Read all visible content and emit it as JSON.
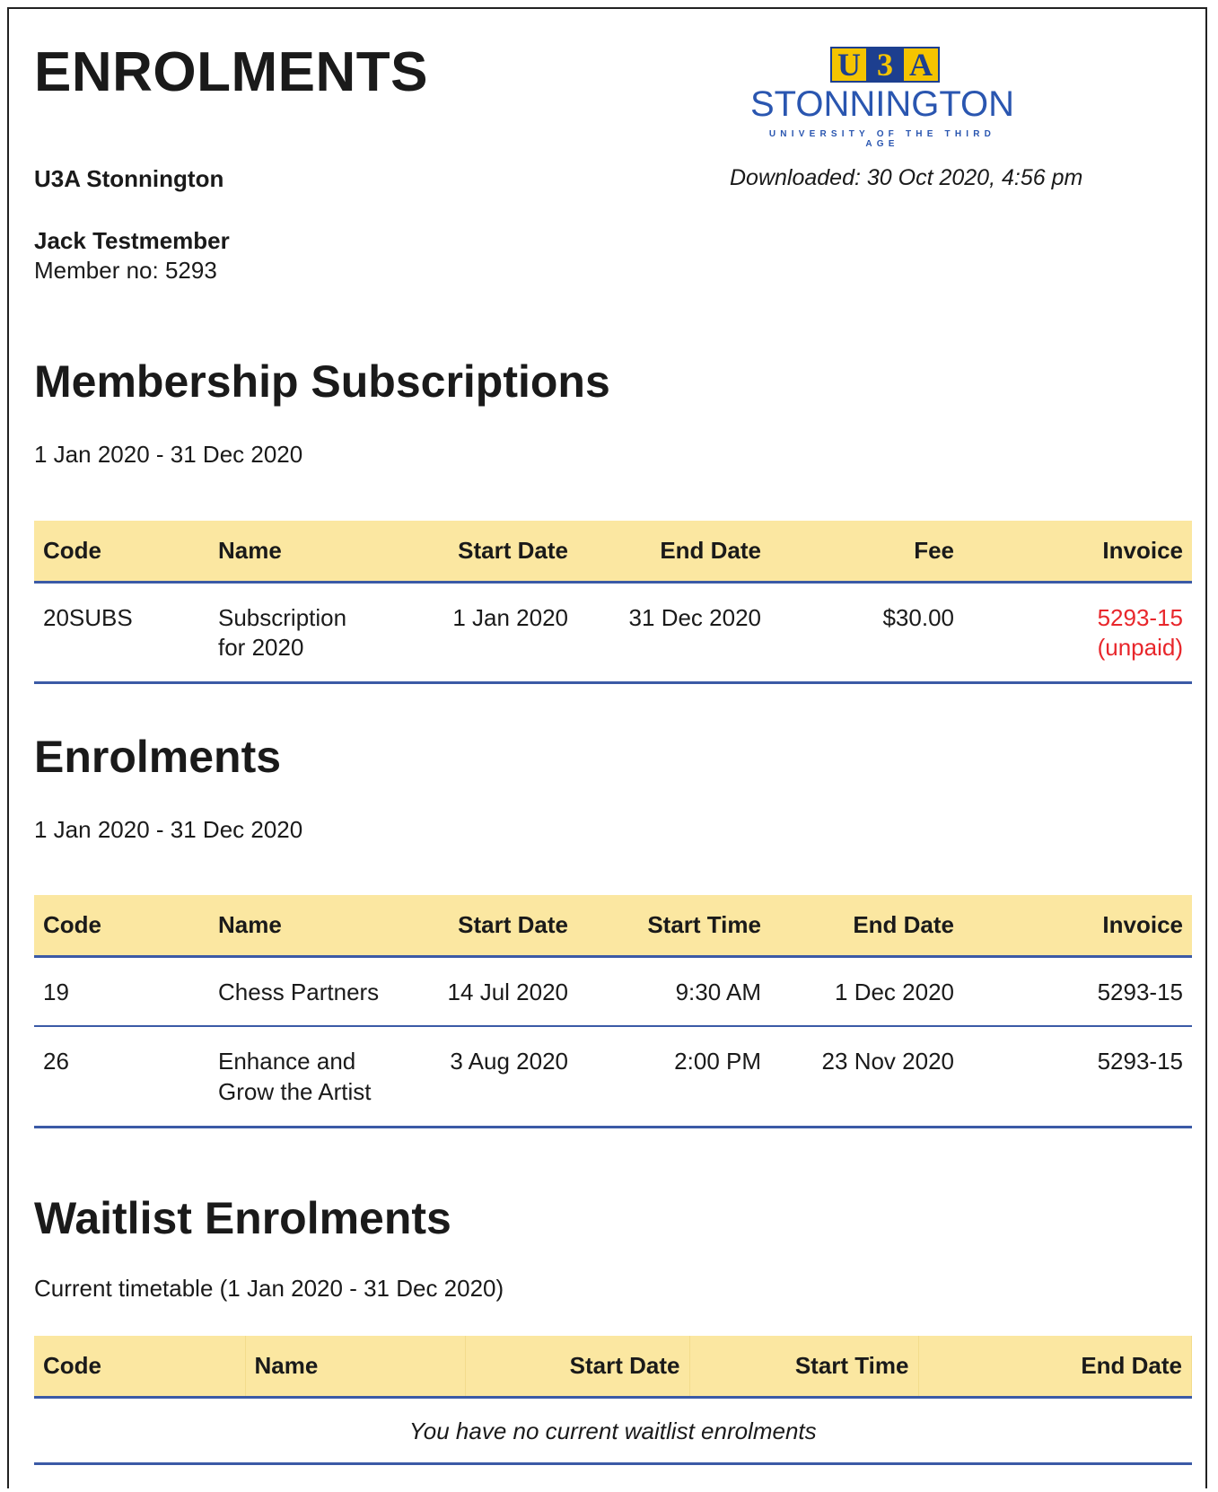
{
  "document": {
    "title": "ENROLMENTS",
    "org_name": "U3A Stonnington",
    "downloaded": "Downloaded: 30 Oct 2020, 4:56 pm",
    "member_name": "Jack Testmember",
    "member_no": "Member no: 5293"
  },
  "logo": {
    "letters": [
      "U",
      "3",
      "A"
    ],
    "name": "STONNINGTON",
    "tagline": "UNIVERSITY OF THE THIRD AGE",
    "colors": {
      "blue": "#1d3f8f",
      "yellow": "#f5c400",
      "text_blue": "#2a56b0"
    }
  },
  "colors": {
    "header_bg": "#fbe7a1",
    "rule": "#3b5aa6",
    "unpaid": "#e8262b"
  },
  "subscriptions": {
    "title": "Membership Subscriptions",
    "period": "1 Jan 2020 - 31 Dec 2020",
    "columns": [
      "Code",
      "Name",
      "Start Date",
      "End Date",
      "Fee",
      "Invoice"
    ],
    "rows": [
      {
        "code": "20SUBS",
        "name_line1": "Subscription",
        "name_line2": "for 2020",
        "start": "1 Jan 2020",
        "end": "31 Dec 2020",
        "fee": "$30.00",
        "invoice": "5293-15",
        "invoice_status": "(unpaid)"
      }
    ]
  },
  "enrolments": {
    "title": "Enrolments",
    "period": "1 Jan 2020 - 31 Dec 2020",
    "columns": [
      "Code",
      "Name",
      "Start Date",
      "Start Time",
      "End Date",
      "Invoice"
    ],
    "rows": [
      {
        "code": "19",
        "name_line1": "Chess Partners",
        "name_line2": "",
        "start": "14 Jul 2020",
        "time": "9:30 AM",
        "end": "1 Dec 2020",
        "invoice": "5293-15"
      },
      {
        "code": "26",
        "name_line1": "Enhance and",
        "name_line2": "Grow the Artist",
        "start": "3 Aug 2020",
        "time": "2:00 PM",
        "end": "23 Nov 2020",
        "invoice": "5293-15"
      }
    ]
  },
  "waitlist": {
    "title": "Waitlist Enrolments",
    "period": "Current timetable (1 Jan 2020 - 31 Dec 2020)",
    "columns": [
      "Code",
      "Name",
      "Start Date",
      "Start Time",
      "End Date"
    ],
    "empty_message": "You have no current waitlist enrolments"
  }
}
